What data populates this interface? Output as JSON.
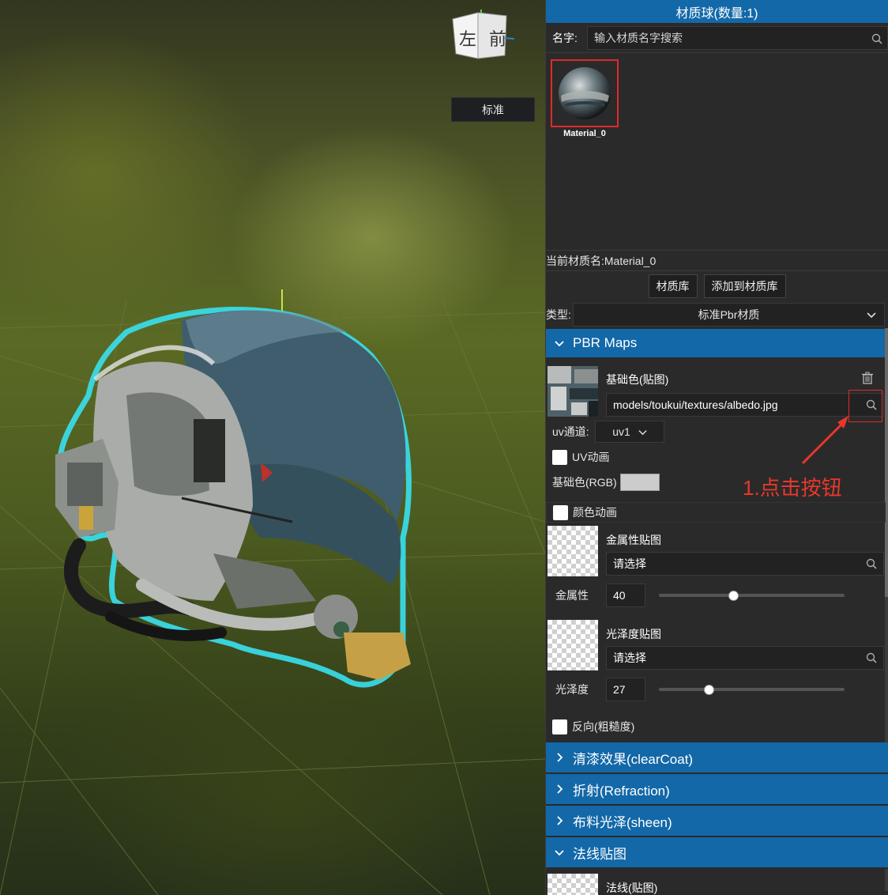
{
  "viewport": {
    "view_cube": {
      "left_face": "左",
      "front_face": "前"
    },
    "mode_button": "标准"
  },
  "panel": {
    "title": "材质球(数量:1)",
    "search": {
      "label": "名字:",
      "placeholder": "输入材质名字搜索"
    },
    "materials": [
      {
        "name": "Material_0",
        "selected": true
      }
    ],
    "current_material": "当前材质名:Material_0",
    "buttons": {
      "library": "材质库",
      "add_to_library": "添加到材质库"
    },
    "type": {
      "label": "类型:",
      "value": "标准Pbr材质"
    }
  },
  "pbr": {
    "title": "PBR Maps",
    "base_color": {
      "label": "基础色(贴图)",
      "path": "models/toukui/textures/albedo.jpg",
      "uv_label": "uv通道:",
      "uv_value": "uv1",
      "uv_anim_label": "UV动画",
      "rgb_label": "基础色(RGB)",
      "rgb_color": "#cccccc",
      "color_anim_label": "颜色动画"
    },
    "metal_map": {
      "label": "金属性贴图",
      "placeholder": "请选择"
    },
    "metalness": {
      "label": "金属性",
      "value": "40",
      "fraction": 0.4
    },
    "gloss_map": {
      "label": "光泽度贴图",
      "placeholder": "请选择"
    },
    "glossiness": {
      "label": "光泽度",
      "value": "27",
      "fraction": 0.27
    },
    "invert_label": "反向(粗糙度)"
  },
  "sections": {
    "clearcoat": "清漆效果(clearCoat)",
    "refraction": "折射(Refraction)",
    "sheen": "布料光泽(sheen)",
    "normal": "法线贴图"
  },
  "normal_map": {
    "label": "法线(贴图)"
  },
  "annotation": {
    "text": "1.点击按钮",
    "color": "#e8372c"
  },
  "colors": {
    "accent": "#1368a8",
    "panel_bg": "#2a2a2a",
    "highlight": "#e02a2a"
  }
}
